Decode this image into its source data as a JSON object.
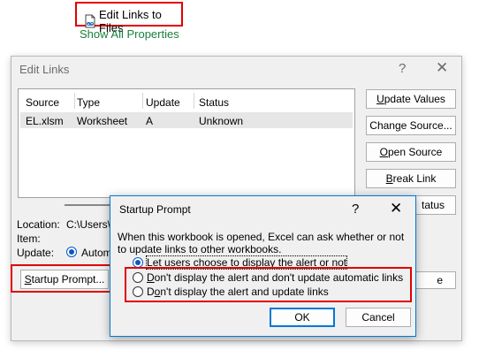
{
  "file_info": {
    "edit_links_label": "Edit Links to Files",
    "show_all_label": "Show All Properties"
  },
  "edit_links_dialog": {
    "title": "Edit Links",
    "help": "?",
    "close": "✕",
    "columns": [
      "Source",
      "Type",
      "Update",
      "Status"
    ],
    "rows": [
      {
        "source": "EL.xlsm",
        "type": "Worksheet",
        "update": "A",
        "status": "Unknown"
      }
    ],
    "buttons": {
      "update_values": {
        "pre": "",
        "key": "U",
        "post": "pdate Values"
      },
      "change_source": {
        "pre": "Chan",
        "key": "g",
        "post": "e Source..."
      },
      "open_source": {
        "pre": "",
        "key": "O",
        "post": "pen Source"
      },
      "break_link": {
        "pre": "",
        "key": "B",
        "post": "reak Link"
      },
      "check_status_partial": "tatus",
      "close_partial": "e"
    },
    "location_label": "Location:",
    "location_value": "C:\\Users\\j",
    "item_label": "Item:",
    "update_label": "Update:",
    "update_value": "Autom",
    "startup_prompt": {
      "pre": "",
      "key": "S",
      "post": "tartup Prompt..."
    }
  },
  "startup_dialog": {
    "title": "Startup Prompt",
    "help": "?",
    "close": "✕",
    "description": "When this workbook is opened, Excel can ask whether or not to update links to other workbooks.",
    "options": [
      {
        "pre": "",
        "key": "L",
        "post": "et users choose to display the alert or not",
        "selected": true
      },
      {
        "pre": "",
        "key": "D",
        "post": "on't display the alert and don't update automatic links",
        "selected": false
      },
      {
        "pre": "D",
        "key": "o",
        "post": "n't display the alert and update links",
        "selected": false
      }
    ],
    "ok": "OK",
    "cancel": "Cancel"
  },
  "colors": {
    "highlight_red": "#e00000",
    "accent_blue": "#0078d7",
    "link_green": "#1a7f3c"
  }
}
